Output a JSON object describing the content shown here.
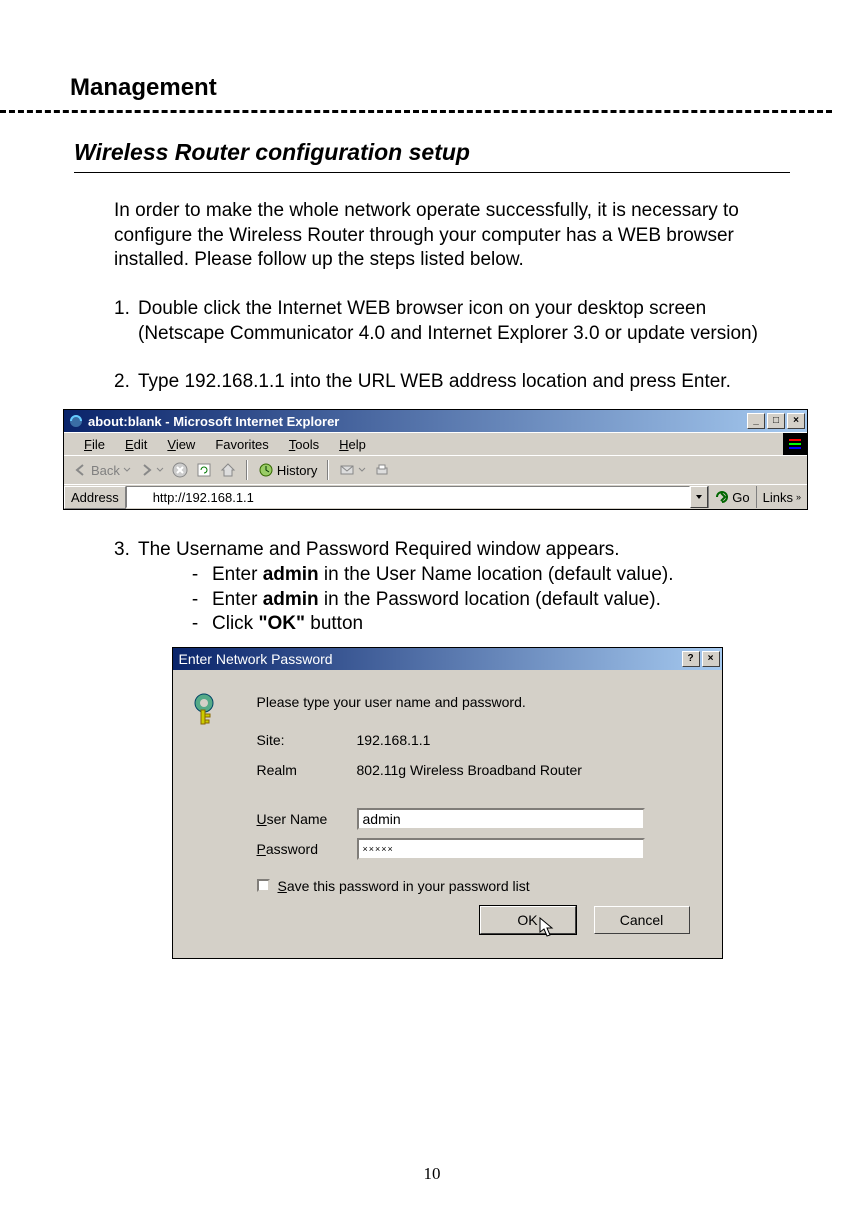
{
  "page_number": "10",
  "heading1": "Management",
  "heading2": "Wireless Router configuration setup",
  "intro": "In order to make the whole network operate successfully, it is necessary to configure the Wireless Router through your computer has a WEB browser installed. Please follow up the steps listed below.",
  "step1_num": "1.",
  "step1": "Double click the Internet WEB browser icon on your desktop screen (Netscape Communicator 4.0 and Internet Explorer 3.0 or update version)",
  "step2_num": "2.",
  "step2": "Type 192.168.1.1 into the URL WEB address location and press Enter.",
  "step3_num": "3.",
  "step3": "The Username and Password Required window appears.",
  "sub1a": "Enter ",
  "sub1b": "admin",
  "sub1c": " in the User Name location (default value).",
  "sub2a": "Enter ",
  "sub2b": "admin",
  "sub2c": " in the Password location (default value).",
  "sub3a": "Click ",
  "sub3b": "\"OK\"",
  "sub3c": " button",
  "dash": "-",
  "ie": {
    "title": "about:blank - Microsoft Internet Explorer",
    "menu": {
      "file": "File",
      "edit": "Edit",
      "view": "View",
      "favorites": "Favorites",
      "tools": "Tools",
      "help": "Help"
    },
    "toolbar": {
      "back": "Back",
      "history": "History"
    },
    "address_label": "Address",
    "url": "http://192.168.1.1",
    "go": "Go",
    "links": "Links"
  },
  "dialog": {
    "title": "Enter Network Password",
    "prompt": "Please type your user name and password.",
    "site_label": "Site:",
    "site_value": "192.168.1.1",
    "realm_label": "Realm",
    "realm_value": "802.11g Wireless Broadband Router",
    "user_label": "User Name",
    "user_value": "admin",
    "pass_label": "Password",
    "pass_value": "×××××",
    "save_label": "Save this password in your password list",
    "ok": "OK",
    "cancel": "Cancel"
  }
}
